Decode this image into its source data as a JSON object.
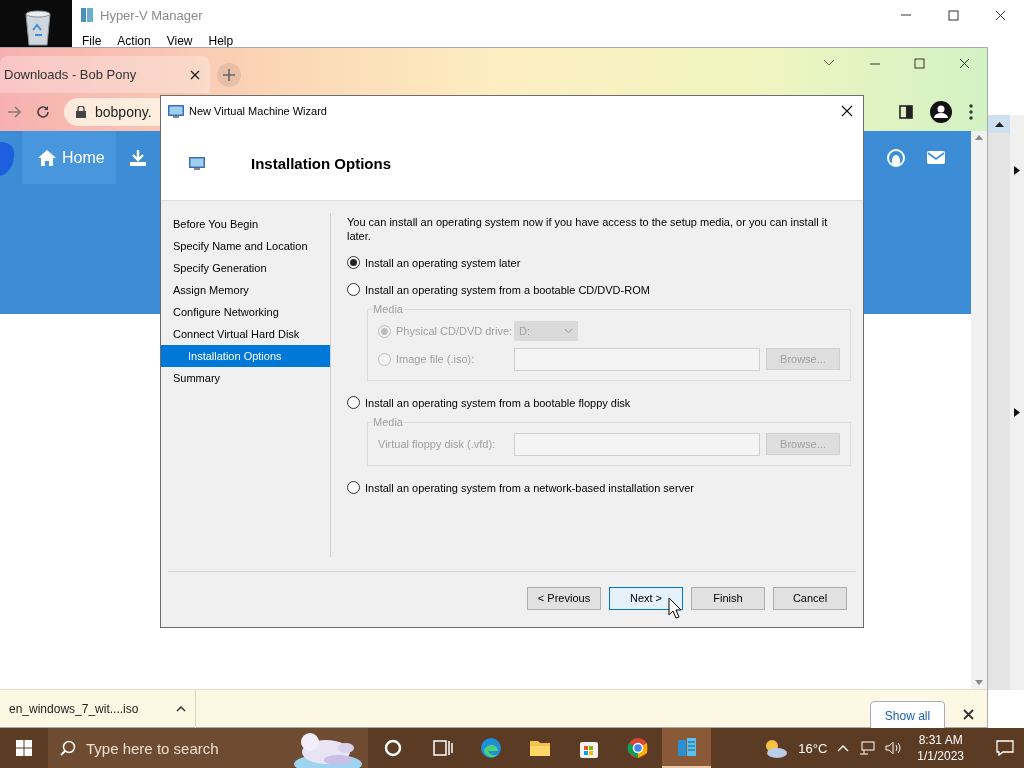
{
  "hyperv": {
    "title": "Hyper-V Manager",
    "menu": [
      "File",
      "Action",
      "View",
      "Help"
    ]
  },
  "browser": {
    "tab": {
      "title": "Downloads - Bob Pony",
      "selected": true
    },
    "address": "bobpony.",
    "nav_home": "Home",
    "download": {
      "file": "en_windows_7_wit....iso",
      "show_all": "Show all"
    }
  },
  "wizard": {
    "title": "New Virtual Machine Wizard",
    "heading": "Installation Options",
    "steps": [
      {
        "label": "Before You Begin",
        "selected": false
      },
      {
        "label": "Specify Name and Location",
        "selected": false
      },
      {
        "label": "Specify Generation",
        "selected": false
      },
      {
        "label": "Assign Memory",
        "selected": false
      },
      {
        "label": "Configure Networking",
        "selected": false
      },
      {
        "label": "Connect Virtual Hard Disk",
        "selected": false
      },
      {
        "label": "Installation Options",
        "selected": true
      },
      {
        "label": "Summary",
        "selected": false
      }
    ],
    "intro": "You can install an operating system now if you have access to the setup media, or you can install it later.",
    "options": [
      {
        "label": "Install an operating system later",
        "selected": true
      },
      {
        "label": "Install an operating system from a bootable CD/DVD-ROM",
        "selected": false,
        "media": {
          "title": "Media",
          "disabled": true,
          "rows": [
            {
              "kind": "drive",
              "label": "Physical CD/DVD drive:",
              "selected": true,
              "value": "D:"
            },
            {
              "label": "Image file (.iso):",
              "selected": false,
              "button": "Browse..."
            }
          ]
        }
      },
      {
        "label": "Install an operating system from a bootable floppy disk",
        "selected": false,
        "media": {
          "title": "Media",
          "disabled": true,
          "rows": [
            {
              "kind": "file",
              "label": "Virtual floppy disk (.vfd):",
              "button": "Browse..."
            }
          ]
        }
      },
      {
        "label": "Install an operating system from a network-based installation server",
        "selected": false
      }
    ],
    "buttons": [
      {
        "label": "< Previous",
        "focused": false
      },
      {
        "label": "Next >",
        "focused": true
      },
      {
        "label": "Finish",
        "focused": false
      },
      {
        "label": "Cancel",
        "focused": false
      }
    ]
  },
  "taskbar": {
    "search_placeholder": "Type here to search",
    "apps": [
      {
        "kind": "cortana",
        "selected": false
      },
      {
        "kind": "task-view",
        "selected": false
      },
      {
        "kind": "edge",
        "selected": false
      },
      {
        "kind": "explorer",
        "selected": false
      },
      {
        "kind": "store",
        "selected": false
      },
      {
        "kind": "chrome",
        "selected": false
      },
      {
        "kind": "hyperv",
        "selected": true
      }
    ],
    "temperature": "16°C",
    "time": "8:31 AM",
    "date": "1/1/2023"
  }
}
